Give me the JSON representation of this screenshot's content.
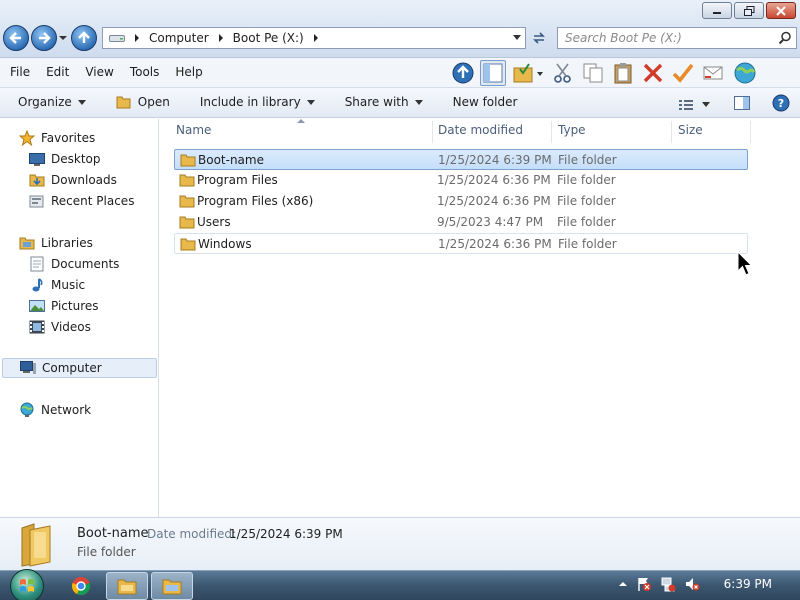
{
  "address": {
    "segments": [
      "Computer",
      "Boot Pe (X:)"
    ]
  },
  "search": {
    "placeholder": "Search Boot Pe (X:)"
  },
  "menu": [
    "File",
    "Edit",
    "View",
    "Tools",
    "Help"
  ],
  "commands": {
    "organize": "Organize",
    "open": "Open",
    "include_in_library": "Include in library",
    "share_with": "Share with",
    "new_folder": "New folder"
  },
  "nav": {
    "favorites": "Favorites",
    "desktop": "Desktop",
    "downloads": "Downloads",
    "recent_places": "Recent Places",
    "libraries": "Libraries",
    "documents": "Documents",
    "music": "Music",
    "pictures": "Pictures",
    "videos": "Videos",
    "computer": "Computer",
    "network": "Network"
  },
  "columns": {
    "name": "Name",
    "date_modified": "Date modified",
    "type": "Type",
    "size": "Size"
  },
  "files": [
    {
      "name": "Boot-name",
      "date": "1/25/2024 6:39 PM",
      "type": "File folder"
    },
    {
      "name": "Program Files",
      "date": "1/25/2024 6:36 PM",
      "type": "File folder"
    },
    {
      "name": "Program Files (x86)",
      "date": "1/25/2024 6:36 PM",
      "type": "File folder"
    },
    {
      "name": "Users",
      "date": "9/5/2023 4:47 PM",
      "type": "File folder"
    },
    {
      "name": "Windows",
      "date": "1/25/2024 6:36 PM",
      "type": "File folder"
    }
  ],
  "details": {
    "name": "Boot-name",
    "date_label": "Date modified:",
    "date_value": "1/25/2024 6:39 PM",
    "type": "File folder"
  },
  "taskbar": {
    "clock": "6:39 PM"
  },
  "colors": {
    "selection": "#c4defa",
    "accent": "#2f6fb6",
    "folder": "#e8b84a"
  }
}
